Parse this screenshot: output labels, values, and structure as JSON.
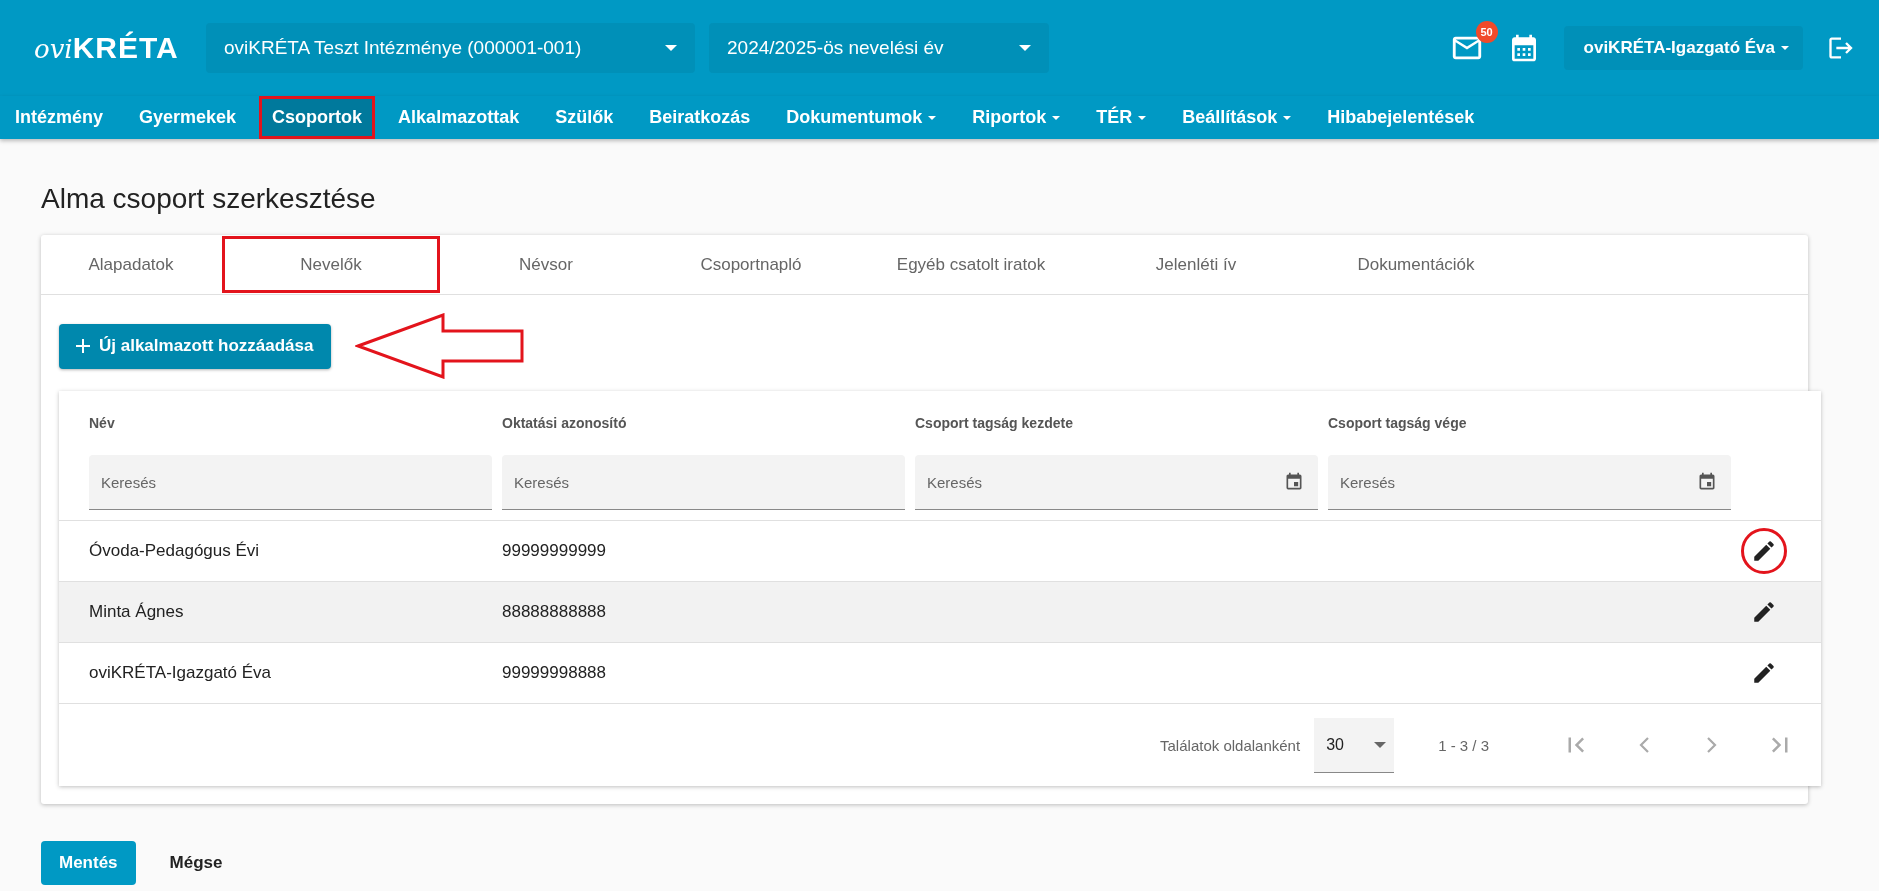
{
  "header": {
    "logo_prefix": "ovi",
    "logo_main": "KRÉTA",
    "institution": "oviKRÉTA Teszt Intézménye (000001-001)",
    "school_year": "2024/2025-ös nevelési év",
    "mail_count": "50",
    "user": "oviKRÉTA-Igazgató Éva"
  },
  "nav": [
    {
      "label": "Intézmény",
      "dropdown": false,
      "selected": false,
      "highlighted": false
    },
    {
      "label": "Gyermekek",
      "dropdown": false,
      "selected": false,
      "highlighted": false
    },
    {
      "label": "Csoportok",
      "dropdown": false,
      "selected": true,
      "highlighted": true
    },
    {
      "label": "Alkalmazottak",
      "dropdown": false,
      "selected": false,
      "highlighted": false
    },
    {
      "label": "Szülők",
      "dropdown": false,
      "selected": false,
      "highlighted": false
    },
    {
      "label": "Beiratkozás",
      "dropdown": false,
      "selected": false,
      "highlighted": false
    },
    {
      "label": "Dokumentumok",
      "dropdown": true,
      "selected": false,
      "highlighted": false
    },
    {
      "label": "Riportok",
      "dropdown": true,
      "selected": false,
      "highlighted": false
    },
    {
      "label": "TÉR",
      "dropdown": true,
      "selected": false,
      "highlighted": false
    },
    {
      "label": "Beállítások",
      "dropdown": true,
      "selected": false,
      "highlighted": false
    },
    {
      "label": "Hibabejelentések",
      "dropdown": false,
      "selected": false,
      "highlighted": false
    }
  ],
  "page_title": "Alma csoport szerkesztése",
  "tabs": [
    {
      "label": "Alapadatok",
      "highlighted": false
    },
    {
      "label": "Nevelők",
      "highlighted": true
    },
    {
      "label": "Névsor",
      "highlighted": false
    },
    {
      "label": "Csoportnapló",
      "highlighted": false
    },
    {
      "label": "Egyéb csatolt iratok",
      "highlighted": false
    },
    {
      "label": "Jelenléti ív",
      "highlighted": false
    },
    {
      "label": "Dokumentációk",
      "highlighted": false
    }
  ],
  "add_button": {
    "label": "Új alkalmazott hozzáadása",
    "arrow_callout": true
  },
  "table": {
    "columns": [
      {
        "label": "Név",
        "filter_placeholder": "Keresés",
        "kind": "text"
      },
      {
        "label": "Oktatási azonosító",
        "filter_placeholder": "Keresés",
        "kind": "text"
      },
      {
        "label": "Csoport tagság kezdete",
        "filter_placeholder": "Keresés",
        "kind": "date"
      },
      {
        "label": "Csoport tagság vége",
        "filter_placeholder": "Keresés",
        "kind": "date"
      }
    ],
    "rows": [
      {
        "name": "Óvoda-Pedagógus Évi",
        "id": "99999999999",
        "hovered": false,
        "edit_circled": true
      },
      {
        "name": "Minta Ágnes",
        "id": "88888888888",
        "hovered": true,
        "edit_circled": false
      },
      {
        "name": "oviKRÉTA-Igazgató Éva",
        "id": "99999998888",
        "hovered": false,
        "edit_circled": false
      }
    ],
    "pagination": {
      "page_size_label": "Találatok oldalanként",
      "page_size": "30",
      "range": "1 - 3 / 3"
    }
  },
  "footer_buttons": [
    {
      "label": "Mentés",
      "kind": "primary"
    },
    {
      "label": "Mégse",
      "kind": "text"
    }
  ]
}
